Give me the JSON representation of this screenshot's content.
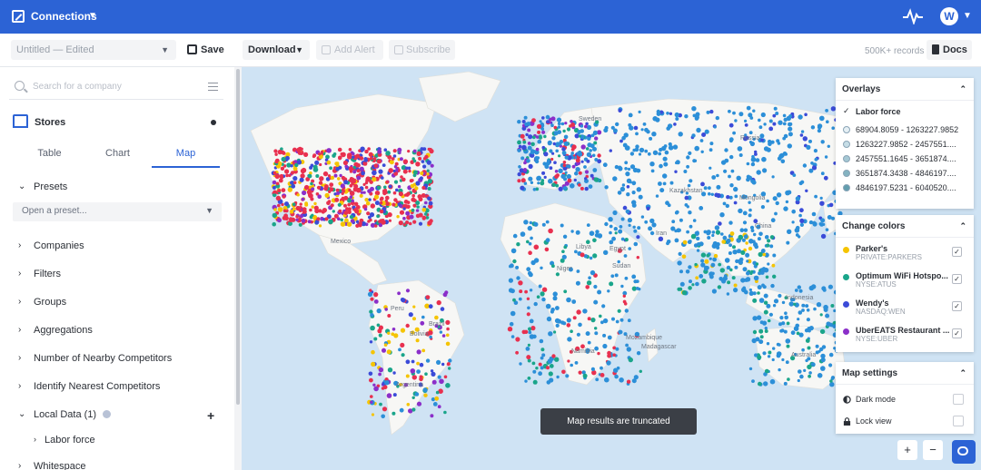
{
  "app": {
    "title": "Connections",
    "user_initial": "W"
  },
  "toolbar": {
    "document_name": "Untitled — Edited",
    "save_label": "Save",
    "download_label": "Download",
    "add_alert_label": "Add Alert",
    "subscribe_label": "Subscribe",
    "records": "500K+ records",
    "docs_label": "Docs"
  },
  "sidebar": {
    "search_placeholder": "Search for a company",
    "dataset": "Stores",
    "tabs": [
      "Table",
      "Chart",
      "Map"
    ],
    "active_tab": "Map",
    "presets_label": "Presets",
    "preset_placeholder": "Open a preset...",
    "sections": [
      "Companies",
      "Filters",
      "Groups",
      "Aggregations",
      "Number of Nearby Competitors",
      "Identify Nearest Competitors"
    ],
    "local_data_label": "Local Data",
    "local_data_count": "(1)",
    "local_data_item": "Labor force",
    "whitespace_label": "Whitespace"
  },
  "map": {
    "toast": "Map results are truncated",
    "labels": [
      "Russia",
      "Kazakhstan",
      "Mongolia",
      "China",
      "Libya",
      "Egypt",
      "Iran",
      "Niger",
      "Sudan",
      "Mexico",
      "Peru",
      "Brazil",
      "Bolivia",
      "Argentina",
      "Namibia",
      "Mozambique",
      "Madagascar",
      "Indonesia",
      "Australia",
      "Sweden"
    ],
    "zoom_in": "+",
    "zoom_out": "−"
  },
  "overlays": {
    "title": "Overlays",
    "layer": "Labor force",
    "ranges": [
      {
        "label": "68904.8059 - 1263227.9852",
        "color": "#e6f0f5"
      },
      {
        "label": "1263227.9852 - 2457551....",
        "color": "#c6dde6"
      },
      {
        "label": "2457551.1645 - 3651874....",
        "color": "#a5c8d4"
      },
      {
        "label": "3651874.3438 - 4846197....",
        "color": "#84b3c1"
      },
      {
        "label": "4846197.5231 - 6040520....",
        "color": "#629eae"
      }
    ]
  },
  "colors_panel": {
    "title": "Change colors",
    "companies": [
      {
        "name": "Parker's",
        "ticker": "PRIVATE:PARKERS",
        "color": "#f5c400"
      },
      {
        "name": "Optimum WiFi Hotspo...",
        "ticker": "NYSE:ATUS",
        "color": "#1aa58a"
      },
      {
        "name": "Wendy's",
        "ticker": "NASDAQ:WEN",
        "color": "#3b4bd8"
      },
      {
        "name": "UberEATS Restaurant ...",
        "ticker": "NYSE:UBER",
        "color": "#8b2fc9"
      }
    ]
  },
  "settings_panel": {
    "title": "Map settings",
    "dark_mode": "Dark mode",
    "lock_view": "Lock view"
  }
}
